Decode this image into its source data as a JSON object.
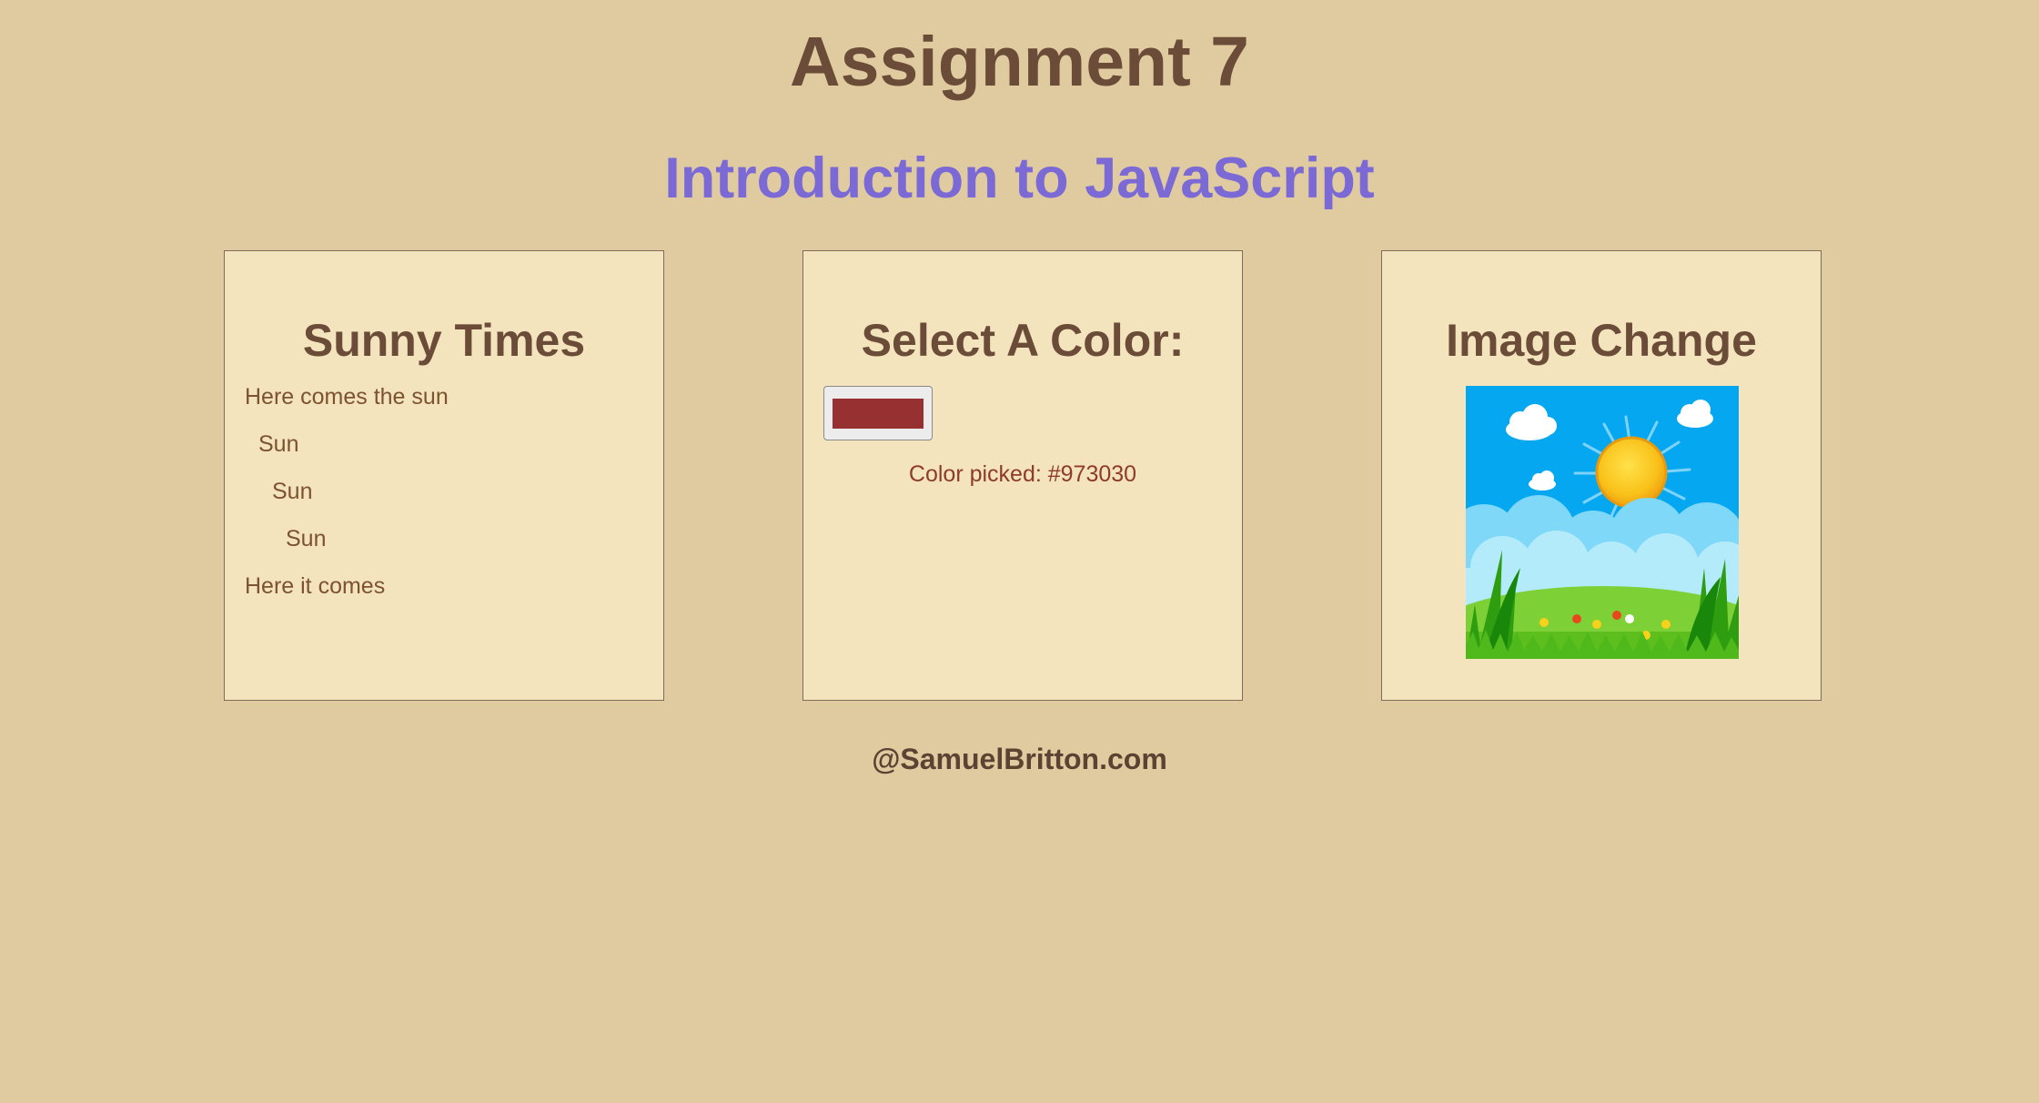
{
  "header": {
    "title": "Assignment 7",
    "subtitle": "Introduction to JavaScript"
  },
  "cards": {
    "sunny": {
      "title": "Sunny Times",
      "lines": [
        "Here comes the sun",
        "Sun",
        "Sun",
        "Sun",
        "Here it comes"
      ]
    },
    "color": {
      "title": "Select A Color:",
      "selected_color": "#973030",
      "picked_text": "Color picked: #973030"
    },
    "image": {
      "title": "Image Change",
      "image_icon": "sunny-landscape-icon"
    }
  },
  "footer": {
    "text": "@SamuelBritton.com"
  },
  "colors": {
    "background": "#e0cba0",
    "card": "#f3e4bd",
    "title": "#6b4c38",
    "subtitle": "#7b69d6"
  }
}
